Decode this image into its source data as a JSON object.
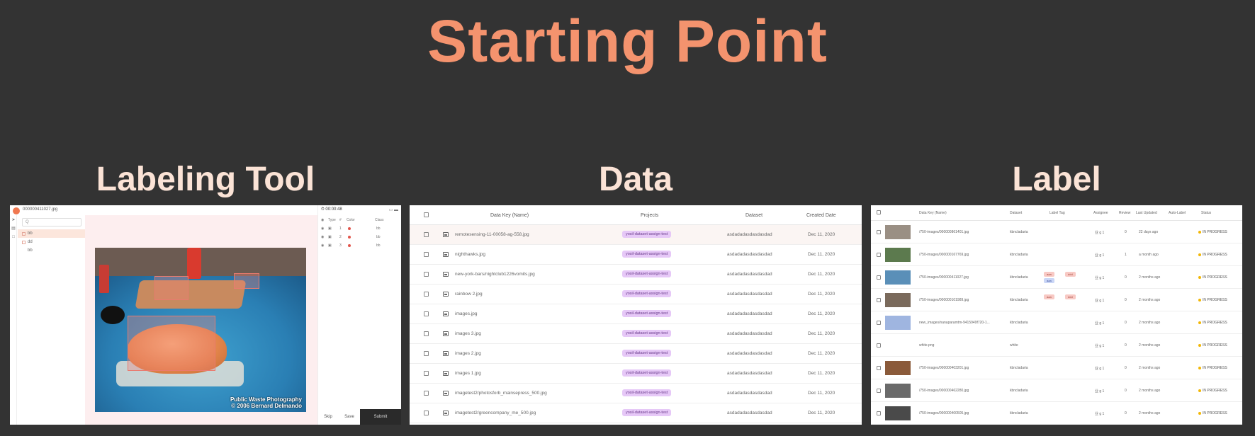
{
  "title": "Starting Point",
  "sections": {
    "tool": "Labeling Tool",
    "data": "Data",
    "label": "Label"
  },
  "labeling_tool": {
    "filename": "000000411027.jpg",
    "search_placeholder": "Q",
    "layers": [
      "bb",
      "dd",
      "bb"
    ],
    "timer": "00:00:48",
    "annotations_header": {
      "type": "Type",
      "num": "#",
      "color": "Color",
      "class": "Class"
    },
    "annotations": [
      {
        "num": "1",
        "class": "bb"
      },
      {
        "num": "2",
        "class": "bb"
      },
      {
        "num": "3",
        "class": "bb"
      }
    ],
    "credit_line1": "Public Waste Photography",
    "credit_line2": "© 2006 Bernard Delmando",
    "buttons": {
      "skip": "Skip",
      "save": "Save",
      "submit": "Submit"
    }
  },
  "data_table": {
    "headers": {
      "key": "Data Key (Name)",
      "projects": "Projects",
      "dataset": "Dataset",
      "created": "Created Date"
    },
    "rows": [
      {
        "key": "remotesensing-11-00058-ag-558.jpg",
        "project": "yosil-dataset-assign-test",
        "dataset": "asdadadasdasdasdad",
        "date": "Dec 11, 2020"
      },
      {
        "key": "nighthawks.jpg",
        "project": "yosil-dataset-assign-test",
        "dataset": "asdadadasdasdasdad",
        "date": "Dec 11, 2020"
      },
      {
        "key": "new-york-bars/nightclub1226vomits.jpg",
        "project": "yosil-dataset-assign-test",
        "dataset": "asdadadasdasdasdad",
        "date": "Dec 11, 2020"
      },
      {
        "key": "rainbow 2.jpg",
        "project": "yosil-dataset-assign-test",
        "dataset": "asdadadasdasdasdad",
        "date": "Dec 11, 2020"
      },
      {
        "key": "images.jpg",
        "project": "yosil-dataset-assign-test",
        "dataset": "asdadadasdasdasdad",
        "date": "Dec 11, 2020"
      },
      {
        "key": "images 3.jpg",
        "project": "yosil-dataset-assign-test",
        "dataset": "asdadadasdasdasdad",
        "date": "Dec 11, 2020"
      },
      {
        "key": "images 2.jpg",
        "project": "yosil-dataset-assign-test",
        "dataset": "asdadadasdasdasdad",
        "date": "Dec 11, 2020"
      },
      {
        "key": "images 1.jpg",
        "project": "yosil-dataset-assign-test",
        "dataset": "asdadadasdasdasdad",
        "date": "Dec 11, 2020"
      },
      {
        "key": "imagetest2/photosforb_mainsepress_500.jpg",
        "project": "yosil-dataset-assign-test",
        "dataset": "asdadadasdasdasdad",
        "date": "Dec 11, 2020"
      },
      {
        "key": "imagetest2/greencompany_me_500.jpg",
        "project": "yosil-dataset-assign-test",
        "dataset": "asdadadasdasdasdad",
        "date": "Dec 11, 2020"
      }
    ]
  },
  "label_table": {
    "headers": {
      "key": "Data Key (Name)",
      "dataset": "Dataset",
      "tag": "Label Tag",
      "assignee": "Assignee",
      "review": "Review",
      "updated": "Last Updated",
      "auto": "Auto-Label",
      "status": "Status"
    },
    "rows": [
      {
        "key": "/750-images/000000861401.jpg",
        "dataset": "kbncladaria",
        "assignee": "业 g 1",
        "review": "0",
        "updated": "22 days ago",
        "status": "IN PROGRESS",
        "tags": []
      },
      {
        "key": "/750-images/000000167769.jpg",
        "dataset": "kbncladaria",
        "assignee": "业 g 1",
        "review": "1",
        "updated": "a month ago",
        "status": "IN PROGRESS",
        "tags": []
      },
      {
        "key": "/750-images/000000411027.jpg",
        "dataset": "kbncladaria",
        "assignee": "业 g 1",
        "review": "0",
        "updated": "2 months ago",
        "status": "IN PROGRESS",
        "tags": [
          {
            "t": "aaa",
            "c": "red"
          },
          {
            "t": "ddd",
            "c": "red"
          },
          {
            "t": "aaa",
            "c": "blue"
          }
        ]
      },
      {
        "key": "/750-images/000000101989.jpg",
        "dataset": "kbncladaria",
        "assignee": "业 g 1",
        "review": "0",
        "updated": "2 months ago",
        "status": "IN PROGRESS",
        "tags": [
          {
            "t": "aaa",
            "c": "red"
          },
          {
            "t": "ddd",
            "c": "red"
          }
        ]
      },
      {
        "key": "new_images/nanaparamtm-9415949f720-1...",
        "dataset": "kbncladaria",
        "assignee": "业 g 1",
        "review": "0",
        "updated": "2 months ago",
        "status": "IN PROGRESS",
        "tags": []
      },
      {
        "key": "white.png",
        "dataset": "white",
        "assignee": "业 g 1",
        "review": "0",
        "updated": "2 months ago",
        "status": "IN PROGRESS",
        "tags": []
      },
      {
        "key": "/750-images/000000403201.jpg",
        "dataset": "kbncladaria",
        "assignee": "业 g 1",
        "review": "0",
        "updated": "2 months ago",
        "status": "IN PROGRESS",
        "tags": []
      },
      {
        "key": "/750-images/000000462280.jpg",
        "dataset": "kbncladaria",
        "assignee": "业 g 1",
        "review": "0",
        "updated": "2 months ago",
        "status": "IN PROGRESS",
        "tags": []
      },
      {
        "key": "/750-images/000000400505.jpg",
        "dataset": "kbncladaria",
        "assignee": "业 g 1",
        "review": "0",
        "updated": "2 months ago",
        "status": "IN PROGRESS",
        "tags": []
      }
    ]
  },
  "colors": {
    "title": "#F4936E",
    "section_title": "#FBE3D6",
    "background": "#333333",
    "pill": "#E6C8F7",
    "status": "#F2B705"
  }
}
